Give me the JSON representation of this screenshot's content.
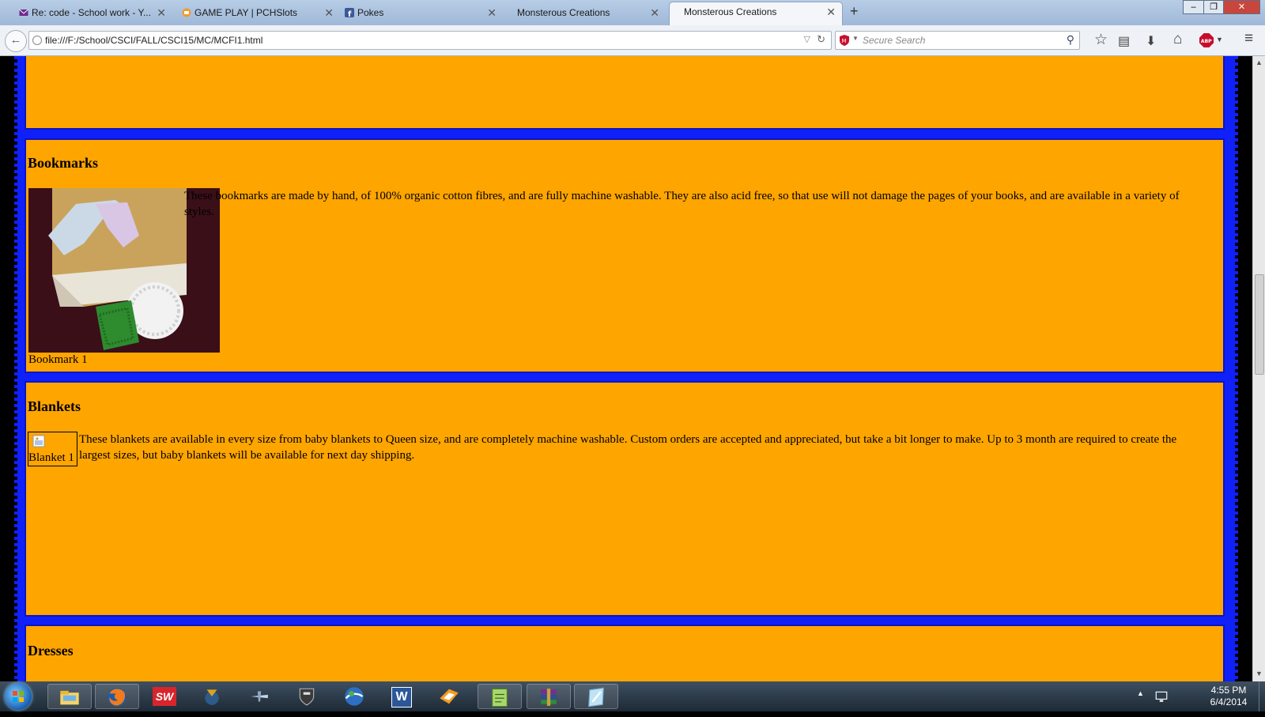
{
  "browser": {
    "tabs": [
      {
        "label": "Re: code - School work - Y...",
        "icon": "mail-icon",
        "active": false
      },
      {
        "label": "GAME PLAY | PCHSlots",
        "icon": "pch-icon",
        "active": false
      },
      {
        "label": "Pokes",
        "icon": "facebook-icon",
        "active": false
      },
      {
        "label": "Monsterous Creations",
        "icon": "",
        "active": false
      },
      {
        "label": "Monsterous Creations",
        "icon": "",
        "active": true
      }
    ],
    "new_tab_label": "+",
    "url": "file:///F:/School/CSCI/FALL/CSCI15/MC/MCFI1.html",
    "search_placeholder": "Secure Search",
    "window_controls": [
      "minimize-icon",
      "restore-icon",
      "close-icon"
    ]
  },
  "page": {
    "sections": [
      {
        "title": "Bookmarks",
        "text": "These bookmarks are made by hand, of 100% organic cotton fibres, and are fully machine washable. They are also acid free, so that use will not damage the pages of your books, and are available in a variety of styles.",
        "caption": "Bookmark 1"
      },
      {
        "title": "Blankets",
        "text": "These blankets are available in every size from baby blankets to Queen size, and are completely machine washable. Custom orders are accepted and appreciated, but take a bit longer to make. Up to 3 month are required to create the largest sizes, but baby blankets will be available for next day shipping.",
        "caption": "Blanket 1"
      },
      {
        "title": "Dresses"
      }
    ],
    "colors": {
      "section_bg": "#ffa500",
      "page_bg": "#1020f8",
      "outer_bg": "#000000"
    }
  },
  "taskbar": {
    "apps": [
      "windows-explorer-icon",
      "firefox-icon",
      "solidworks-icon",
      "mechwarrior-icon",
      "world-of-warplanes-icon",
      "world-of-tanks-icon",
      "google-earth-icon",
      "word-icon",
      "app-icon",
      "notepad-plus-icon",
      "winrar-icon",
      "tablet-icon"
    ],
    "sw_label": "SW",
    "word_label": "W",
    "time": "4:55 PM",
    "date": "6/4/2014"
  }
}
